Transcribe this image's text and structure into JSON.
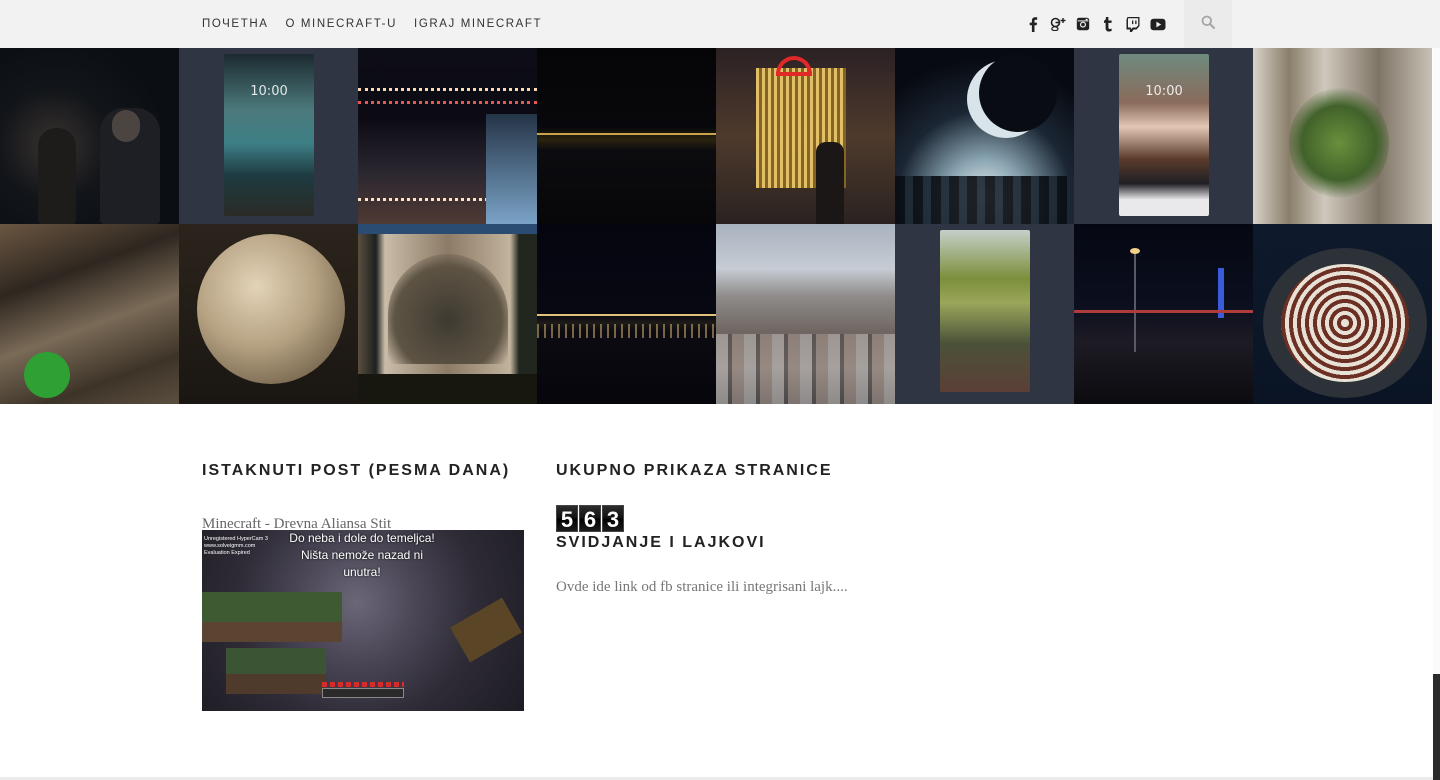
{
  "nav": {
    "items": [
      "ПОЧЕТНА",
      "O MINECRAFT-U",
      "IGRAJ MINECRAFT"
    ]
  },
  "social": {
    "icons": [
      "facebook-icon",
      "google-plus-icon",
      "instagram-icon",
      "tumblr-icon",
      "twitch-icon",
      "youtube-icon"
    ],
    "glyphs": [
      "f",
      "g+",
      "◙",
      "t",
      "▭",
      "▶"
    ]
  },
  "search": {
    "icon": "search-icon"
  },
  "gallery": {
    "phone_clock": "10:00"
  },
  "featured_post": {
    "title": "ISTAKNUTI POST (PESMA DANA)",
    "post_title": "Minecraft - Drevna Aliansa Stit",
    "thumb_caption_1": "Do neba i dole do temeljca!",
    "thumb_caption_2": "Ništa nemože nazad ni",
    "thumb_caption_3": "unutra!",
    "thumb_watermark": "Unregistered HyperCam 3\nwww.solveigmm.com\nEvaluation Expired"
  },
  "page_views": {
    "title": "UKUPNO PRIKAZA STRANICE",
    "digits": [
      "5",
      "6",
      "3"
    ]
  },
  "likes": {
    "title": "SVIDJANJE I LAJKOVI",
    "text": "Ovde ide link od fb stranice ili integrisani lajk...."
  },
  "colors": {
    "topbar": "#f2f2f2",
    "phone_frame_bg": "#2f3542"
  }
}
